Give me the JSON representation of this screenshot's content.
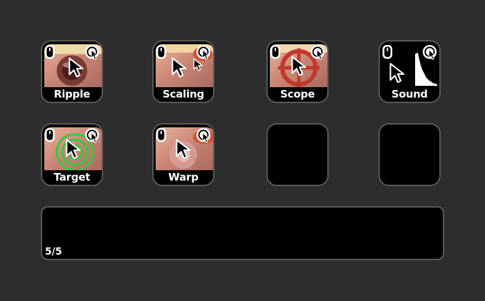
{
  "keys": [
    {
      "label": "Ripple",
      "icon": "ripple-icon"
    },
    {
      "label": "Scaling",
      "icon": "scaling-icon"
    },
    {
      "label": "Scope",
      "icon": "scope-icon"
    },
    {
      "label": "Sound",
      "icon": "sound-icon"
    },
    {
      "label": "Target",
      "icon": "target-icon"
    },
    {
      "label": "Warp",
      "icon": "warp-icon"
    },
    {
      "label": "",
      "icon": ""
    },
    {
      "label": "",
      "icon": ""
    }
  ],
  "status_bar": {
    "page_indicator": "5/5"
  },
  "colors": {
    "background": "#2d2d2d",
    "key_border": "#5a5a5a",
    "scope_red": "#c0392b",
    "target_green": "#2ecc40"
  }
}
